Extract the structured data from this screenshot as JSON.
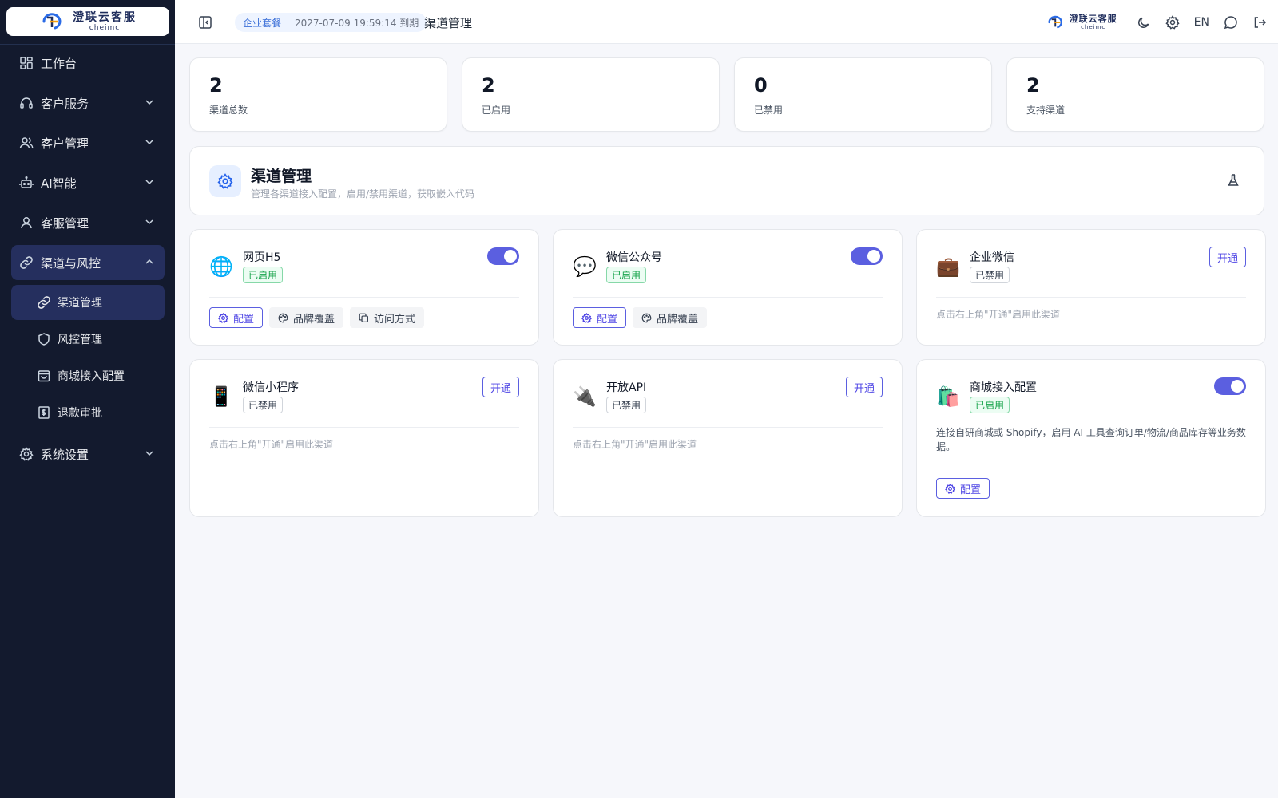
{
  "brand": {
    "name_cn": "澄联云客服",
    "name_en": "cheimc"
  },
  "sidebar": {
    "items": [
      {
        "label": "工作台",
        "icon": "grid-icon"
      },
      {
        "label": "客户服务",
        "icon": "headset-icon"
      },
      {
        "label": "客户管理",
        "icon": "users-icon"
      },
      {
        "label": "AI智能",
        "icon": "bot-icon"
      },
      {
        "label": "客服管理",
        "icon": "user-icon"
      },
      {
        "label": "渠道与风控",
        "icon": "link-icon"
      }
    ],
    "sub_items": [
      {
        "label": "渠道管理",
        "icon": "link-icon"
      },
      {
        "label": "风控管理",
        "icon": "shield-icon"
      },
      {
        "label": "商城接入配置",
        "icon": "shopping-bag-icon"
      },
      {
        "label": "退款审批",
        "icon": "receipt-icon"
      }
    ],
    "settings": {
      "label": "系统设置",
      "icon": "gear-icon"
    }
  },
  "header": {
    "plan_name": "企业套餐",
    "plan_expiry": "2027-07-09 19:59:14 到期",
    "title": "渠道管理",
    "lang": "EN"
  },
  "stats": [
    {
      "value": "2",
      "label": "渠道总数"
    },
    {
      "value": "2",
      "label": "已启用"
    },
    {
      "value": "0",
      "label": "已禁用"
    },
    {
      "value": "2",
      "label": "支持渠道"
    }
  ],
  "section": {
    "title": "渠道管理",
    "desc": "管理各渠道接入配置，启用/禁用渠道，获取嵌入代码"
  },
  "channels": [
    {
      "name": "网页H5",
      "icon": "🌐",
      "status": "已启用",
      "enabled": true,
      "actions": [
        {
          "label": "配置",
          "icon": "gear-icon"
        },
        {
          "label": "品牌覆盖",
          "icon": "palette-icon"
        },
        {
          "label": "访问方式",
          "icon": "copy-icon"
        }
      ]
    },
    {
      "name": "微信公众号",
      "icon": "💬",
      "status": "已启用",
      "enabled": true,
      "actions": [
        {
          "label": "配置",
          "icon": "gear-icon"
        },
        {
          "label": "品牌覆盖",
          "icon": "palette-icon"
        }
      ]
    },
    {
      "name": "企业微信",
      "icon": "💼",
      "status": "已禁用",
      "enabled": false,
      "open_label": "开通",
      "hint": "点击右上角\"开通\"启用此渠道"
    },
    {
      "name": "微信小程序",
      "icon": "📱",
      "status": "已禁用",
      "enabled": false,
      "open_label": "开通",
      "hint": "点击右上角\"开通\"启用此渠道"
    },
    {
      "name": "开放API",
      "icon": "🔌",
      "status": "已禁用",
      "enabled": false,
      "open_label": "开通",
      "hint": "点击右上角\"开通\"启用此渠道"
    },
    {
      "name": "商城接入配置",
      "icon": "🛍️",
      "status": "已启用",
      "enabled": true,
      "desc": "连接自研商城或 Shopify，启用 AI 工具查询订单/物流/商品库存等业务数据。",
      "actions": [
        {
          "label": "配置",
          "icon": "gear-icon"
        }
      ]
    }
  ],
  "colors": {
    "sidebar_bg": "#131a2e",
    "accent": "#5b5fe0",
    "success": "#16a34a",
    "plan_bg": "#eef4ff"
  }
}
